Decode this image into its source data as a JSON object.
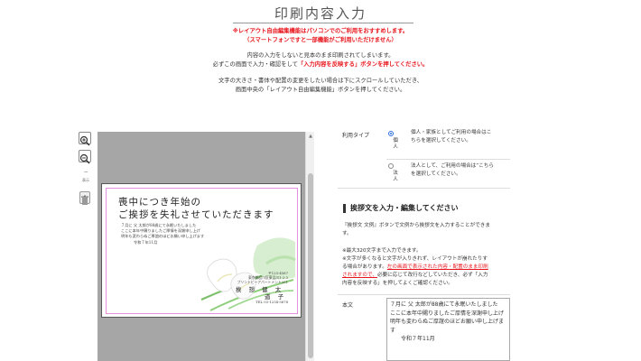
{
  "page": {
    "title": "印刷内容入力",
    "warn_line1": "※レイアウト自由編集機能はパソコンでのご利用をおすすめします。",
    "warn_line2": "（スマートフォンですと一部機能がご利用いただけません）",
    "info_line1": "内容の入力をしないと見本のまま印刷されてしまいます。",
    "info_line2_pre": "必ずこの画面で入力・確認をして",
    "info_line2_red": "「入力内容を反映する」ボタンを押してください。",
    "info_line3": "文字の大きさ・書体や配置の変更をしたい場合は下にスクロールしていただき、",
    "info_line4": "画面中央の「レイアウト自由編集機能」ボタンを押してください。"
  },
  "toolbar": {
    "zoom_in": "+",
    "zoom_out": "−",
    "collapse": "−",
    "collapse_label": "表示",
    "trash_label": ""
  },
  "postcard": {
    "heading1": "喪中につき年始の",
    "heading2": "ご挨拶を失礼させていただきます",
    "body1": "７月に 父 太郎が88歳にて永眠いたしました",
    "body2": "ここに本年中賜りましたご厚情を深謝申し上げ",
    "body3": "明年も変わらぬご厚誼のほどお願い申し上げます",
    "date": "令和７年11月",
    "addr1": "〒123-4567",
    "addr2": "東京都品川区東品川1-2-3",
    "addr3": "プリントビーアパートメント201",
    "name1": "挨 拶 健 太",
    "name2": "道 子",
    "tel": "TEL 03-1234-5678"
  },
  "right": {
    "type_label": "利用タイプ",
    "opt1_vertical": "個人",
    "opt1_desc1": "個人・家族としてご利用の場合はこ",
    "opt1_desc2": "ちらを選択してください。",
    "opt2_vertical": "法人",
    "opt2_desc1": "法人として、ご利用の場合は”こちら",
    "opt2_desc2": "を選択してください。",
    "section_title": "挨拶文を入力・編集してください",
    "help1": "『挨拶文 文例』ボタンで文例から挨拶文を入力することができま",
    "help2": "す。",
    "note1": "※最大320文字まで入力できます。",
    "note2": "※文字が多くなると文字が入りきれず、レイアウトが崩れたりす",
    "note3": "る場合があります。",
    "note3_red": "左の画面で表示された内容・配置のまま印刷",
    "note4_red": "されますので、",
    "note4": "必要に応じて改行などしていただき、必ず「入力",
    "note5": "内容を反映する」を押してよくご確認ください。",
    "body_label": "本文",
    "body_text": "７月に 父 太郎が88歳にて永眠いたしました\nここに本年中賜りましたご厚情を深謝申し上げ\n明年も変わらぬご厚誼のほどお願い申し上げます\n　　令和７年11月"
  },
  "colors": {
    "accent_red": "#e8141b",
    "editor_bg": "#a6a6a6",
    "frame_pink": "#e48fe0"
  }
}
